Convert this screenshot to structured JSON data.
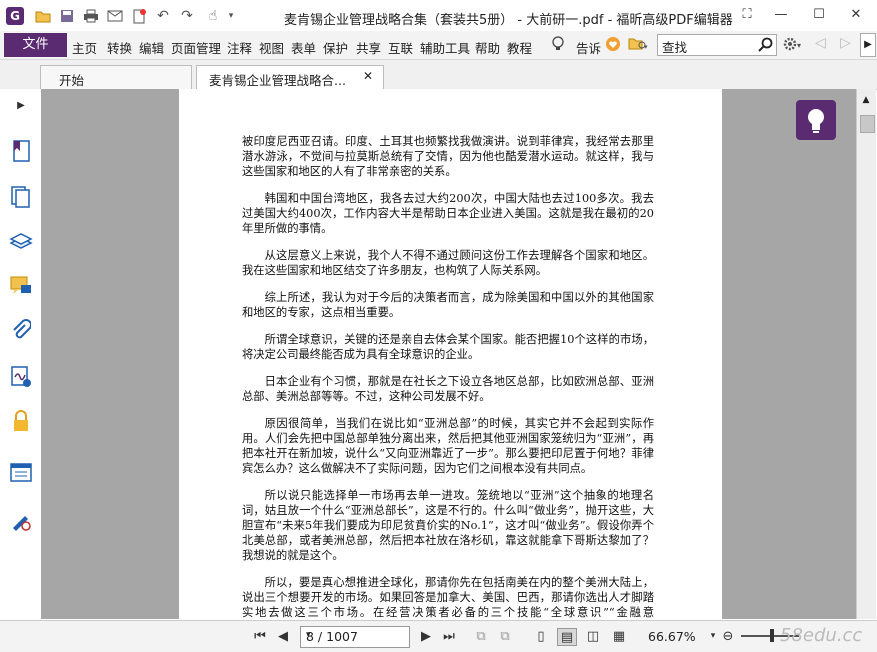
{
  "window": {
    "title": "麦肯锡企业管理战略合集（套装共5册） - 大前研一.pdf - 福昕高级PDF编辑器",
    "logo_letter": "G"
  },
  "menu": {
    "file": "文件",
    "items": [
      "主页",
      "转换",
      "编辑",
      "页面管理",
      "注释",
      "视图",
      "表单",
      "保护",
      "共享",
      "互联",
      "辅助工具",
      "帮助",
      "教程"
    ],
    "tell_me": "告诉",
    "search_value": "查找"
  },
  "tabs": [
    {
      "label": "开始"
    },
    {
      "label": "麦肯锡企业管理战略合..."
    }
  ],
  "document": {
    "paragraphs": [
      "被印度尼西亚召请。印度、土耳其也频繁找我做演讲。说到菲律宾，我经常去那里潜水游泳，不觉间与拉莫斯总统有了交情，因为他也酷爱潜水运动。就这样，我与这些国家和地区的人有了非常亲密的关系。",
      "韩国和中国台湾地区，我各去过大约200次，中国大陆也去过100多次。我去过美国大约400次，工作内容大半是帮助日本企业进入美国。这就是我在最初的20年里所做的事情。",
      "从这层意义上来说，我个人不得不通过顾问这份工作去理解各个国家和地区。我在这些国家和地区结交了许多朋友，也构筑了人际关系网。",
      "综上所述，我认为对于今后的决策者而言，成为除美国和中国以外的其他国家和地区的专家，这点相当重要。",
      "所谓全球意识，关键的还是亲自去体会某个国家。能否把握10个这样的市场，将决定公司最终能否成为具有全球意识的企业。",
      "日本企业有个习惯，那就是在社长之下设立各地区总部，比如欧洲总部、亚洲总部、美洲总部等等。不过，这种公司发展不好。",
      "原因很简单，当我们在说比如“亚洲总部”的时候，其实它并不会起到实际作用。人们会先把中国总部单独分离出来，然后把其他亚洲国家笼统归为“亚洲”，再把本社开在新加坡，说什么“又向亚洲靠近了一步”。那么要把印尼置于何地？菲律宾怎么办？这么做解决不了实际问题，因为它们之间根本没有共同点。",
      "所以说只能选择单一市场再去单一进攻。笼统地以“亚洲”这个抽象的地理名词，姑且放一个什么“亚洲总部长”，这是不行的。什么叫“做业务”，抛开这些，大胆宣布“未来5年我们要成为印尼贫賁价实的No.1”，这才叫“做业务”。假设你弄个北美总部，或者美洲总部，然后把本社放在洛杉矶，靠这就能拿下哥斯达黎加了？我想说的就是这个。",
      "所以，要是真心想推进全球化，那请你先在包括南美在内的整个美洲大陆上，说出三个想要开发的市场。如果回答是加拿大、美国、巴西，那请你选出人才脚踏实地去做这三个市场。在经营决策者必备的三个技能“全球意识”“金融意识”“ICT”中，最需要花时间的还要数掌握全球意识。我在马来西亚工作了18年，花了相当长时间才真正掌握了全球意识。要是想随便试试，就必须将，那就请"
    ]
  },
  "status": {
    "page": "8 / 1007",
    "zoom": "66.67%"
  },
  "watermark": "58edu.cc"
}
